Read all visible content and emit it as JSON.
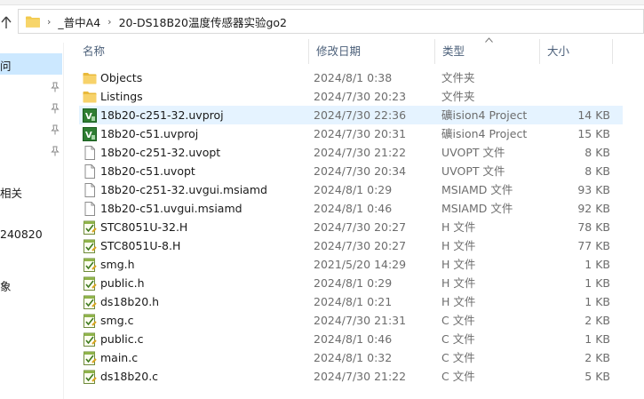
{
  "breadcrumb": {
    "items": [
      "_普中A4",
      "20-DS18B20温度传感器实验go2"
    ],
    "separator": "›"
  },
  "nav": {
    "items": [
      {
        "label": "问"
      },
      {
        "label": "相关"
      },
      {
        "label": "240820"
      },
      {
        "label": "象"
      }
    ]
  },
  "columns": {
    "name": "名称",
    "date": "修改日期",
    "type": "类型",
    "size": "大小"
  },
  "files": [
    {
      "name": "Objects",
      "date": "2024/8/1 0:38",
      "type": "文件夹",
      "size": "",
      "icon": "folder-icon"
    },
    {
      "name": "Listings",
      "date": "2024/7/30 20:23",
      "type": "文件夹",
      "size": "",
      "icon": "folder-icon"
    },
    {
      "name": "18b20-c251-32.uvproj",
      "date": "2024/7/30 22:36",
      "type": "礦ision4 Project",
      "size": "14 KB",
      "icon": "uvision-project-icon"
    },
    {
      "name": "18b20-c51.uvproj",
      "date": "2024/7/30 20:31",
      "type": "礦ision4 Project",
      "size": "15 KB",
      "icon": "uvision-project-icon"
    },
    {
      "name": "18b20-c251-32.uvopt",
      "date": "2024/7/30 21:22",
      "type": "UVOPT 文件",
      "size": "8 KB",
      "icon": "blank-file-icon"
    },
    {
      "name": "18b20-c51.uvopt",
      "date": "2024/7/30 20:34",
      "type": "UVOPT 文件",
      "size": "8 KB",
      "icon": "blank-file-icon"
    },
    {
      "name": "18b20-c251-32.uvgui.msiamd",
      "date": "2024/8/1 0:29",
      "type": "MSIAMD 文件",
      "size": "93 KB",
      "icon": "blank-file-icon"
    },
    {
      "name": "18b20-c51.uvgui.msiamd",
      "date": "2024/8/1 0:46",
      "type": "MSIAMD 文件",
      "size": "92 KB",
      "icon": "blank-file-icon"
    },
    {
      "name": "STC8051U-32.H",
      "date": "2024/7/30 20:27",
      "type": "H 文件",
      "size": "78 KB",
      "icon": "source-file-icon"
    },
    {
      "name": "STC8051U-8.H",
      "date": "2024/7/30 20:27",
      "type": "H 文件",
      "size": "77 KB",
      "icon": "source-file-icon"
    },
    {
      "name": "smg.h",
      "date": "2021/5/20 14:29",
      "type": "H 文件",
      "size": "1 KB",
      "icon": "source-file-icon"
    },
    {
      "name": "public.h",
      "date": "2024/8/1 0:29",
      "type": "H 文件",
      "size": "1 KB",
      "icon": "source-file-icon"
    },
    {
      "name": "ds18b20.h",
      "date": "2024/8/1 0:21",
      "type": "H 文件",
      "size": "1 KB",
      "icon": "source-file-icon"
    },
    {
      "name": "smg.c",
      "date": "2024/7/30 21:31",
      "type": "C 文件",
      "size": "2 KB",
      "icon": "source-file-icon"
    },
    {
      "name": "public.c",
      "date": "2024/8/1 0:46",
      "type": "C 文件",
      "size": "1 KB",
      "icon": "source-file-icon"
    },
    {
      "name": "main.c",
      "date": "2024/8/1 0:32",
      "type": "C 文件",
      "size": "2 KB",
      "icon": "source-file-icon"
    },
    {
      "name": "ds18b20.c",
      "date": "2024/7/30 21:22",
      "type": "C 文件",
      "size": "5 KB",
      "icon": "source-file-icon"
    }
  ],
  "selected_index": 2,
  "colors": {
    "folder": "#f2c94c",
    "selection": "#e5f3ff",
    "nav_selection": "#cce8ff",
    "header_text": "#4c607a",
    "uvision_green": "#2e7d32"
  }
}
